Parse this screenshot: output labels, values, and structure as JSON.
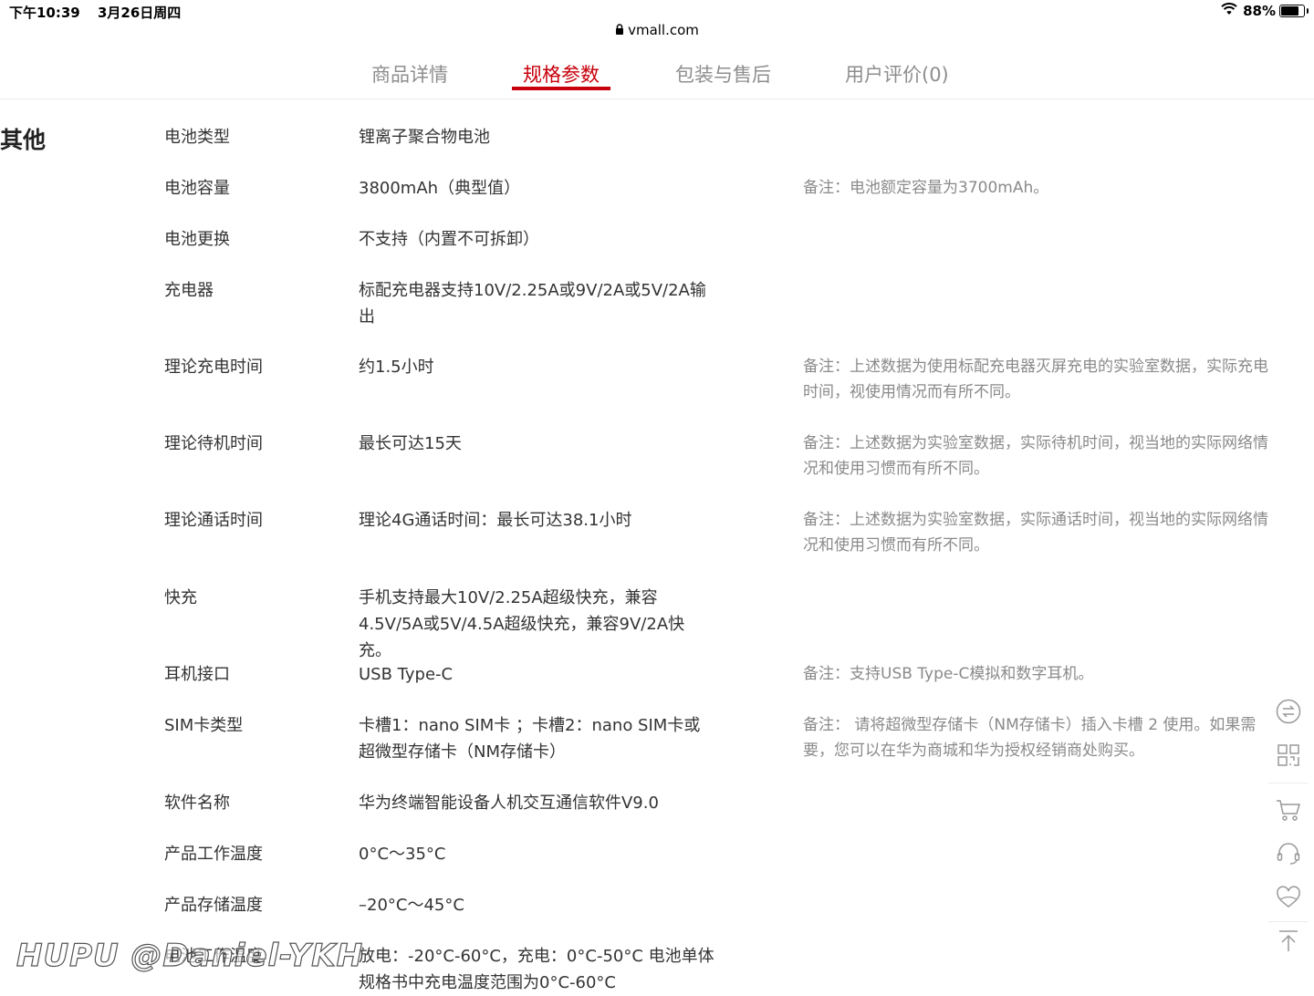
{
  "status_bar": {
    "time": "下午10:39",
    "date": "3月26日周四",
    "battery": "88%",
    "battery_level": 0.88
  },
  "browser": {
    "url": "vmall.com"
  },
  "tabs": [
    {
      "label": "商品详情",
      "active": false
    },
    {
      "label": "规格参数",
      "active": true
    },
    {
      "label": "包装与售后",
      "active": false
    },
    {
      "label": "用户评价(0)",
      "active": false
    }
  ],
  "section": {
    "title": "其他"
  },
  "specs": [
    {
      "label": "电池类型",
      "value": "锂离子聚合物电池",
      "note": ""
    },
    {
      "label": "电池容量",
      "value": "3800mAh（典型值）",
      "note": "备注：电池额定容量为3700mAh。"
    },
    {
      "label": "电池更换",
      "value": "不支持（内置不可拆卸）",
      "note": ""
    },
    {
      "label": "充电器",
      "value": "标配充电器支持10V/2.25A或9V/2A或5V/2A输出",
      "note": ""
    },
    {
      "label": "理论充电时间",
      "value": "约1.5小时",
      "note": "备注：上述数据为使用标配充电器灭屏充电的实验室数据，实际充电时间，视使用情况而有所不同。"
    },
    {
      "label": "理论待机时间",
      "value": "最长可达15天",
      "note": "备注：上述数据为实验室数据，实际待机时间，视当地的实际网络情况和使用习惯而有所不同。"
    },
    {
      "label": "理论通话时间",
      "value": "理论4G通话时间：最长可达38.1小时",
      "note": "备注：上述数据为实验室数据，实际通话时间，视当地的实际网络情况和使用习惯而有所不同。"
    },
    {
      "label": "快充",
      "value": "手机支持最大10V/2.25A超级快充，兼容4.5V/5A或5V/4.5A超级快充，兼容9V/2A快充。",
      "note": ""
    },
    {
      "label": "耳机接口",
      "value": "USB Type-C",
      "note": "备注：支持USB Type-C模拟和数字耳机。"
    },
    {
      "label": "SIM卡类型",
      "value": "卡槽1：nano SIM卡 ；卡槽2：nano SIM卡或超微型存储卡（NM存储卡）",
      "note": "备注： 请将超微型存储卡（NM存储卡）插入卡槽 2 使用。如果需要，您可以在华为商城和华为授权经销商处购买。"
    },
    {
      "label": "软件名称",
      "value": "华为终端智能设备人机交互通信软件V9.0",
      "note": ""
    },
    {
      "label": "产品工作温度",
      "value": "0°C～35°C",
      "note": ""
    },
    {
      "label": "产品存储温度",
      "value": "–20°C～45°C",
      "note": ""
    },
    {
      "label": "电池工作温度",
      "value": "放电：-20°C-60°C，充电：0°C-50°C 电池单体规格书中充电温度范围为0°C-60°C",
      "note": ""
    }
  ],
  "watermark": "HUPU @Daniel-YKH"
}
